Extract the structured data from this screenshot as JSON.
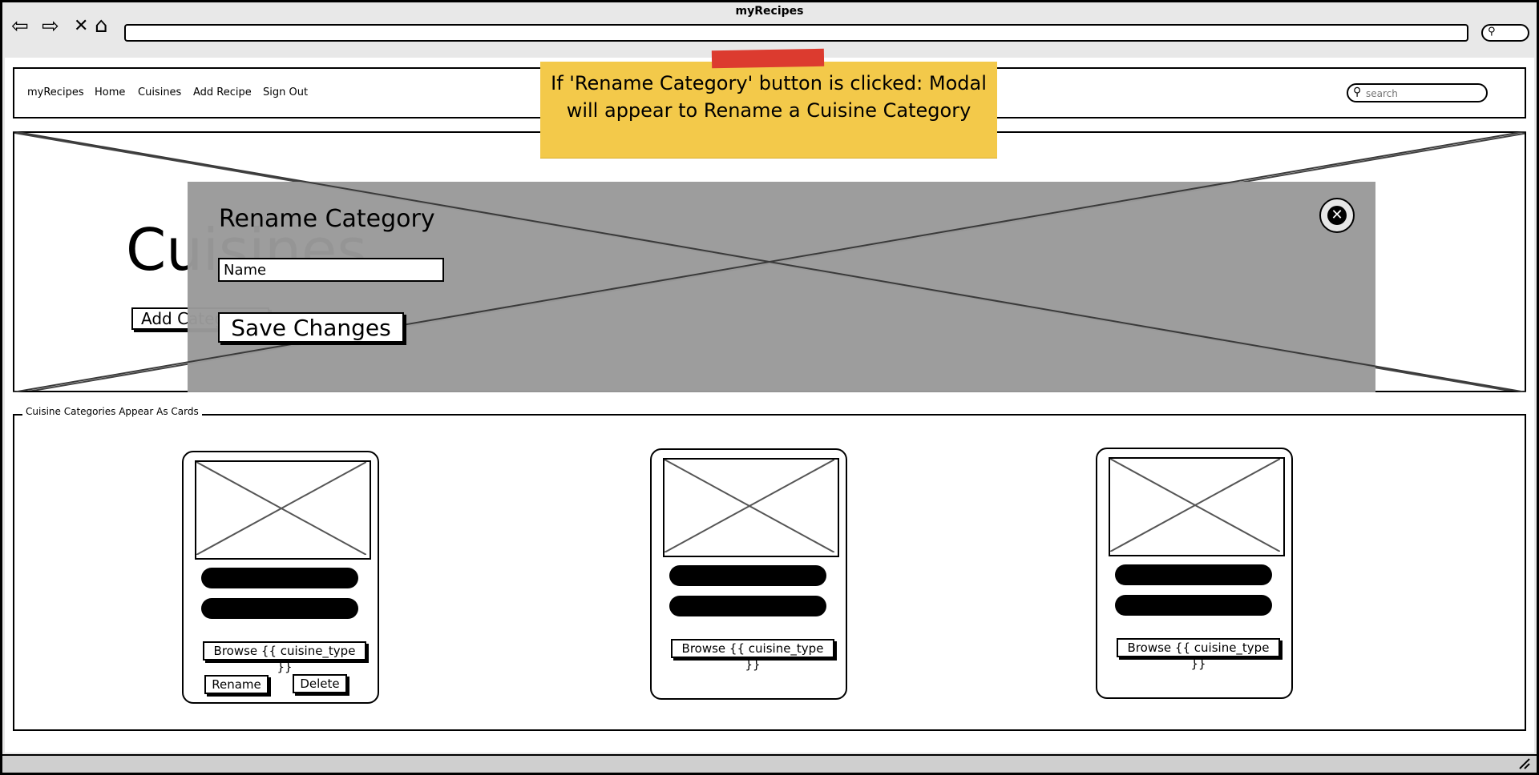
{
  "window": {
    "title": "myRecipes"
  },
  "browser": {
    "back_icon": "⇦",
    "forward_icon": "⇨",
    "stop_icon": "✕",
    "home_icon": "⌂",
    "search_glyph": "⚲"
  },
  "navbar": {
    "brand": "myRecipes",
    "links": [
      "Home",
      "Cuisines",
      "Add Recipe",
      "Sign Out"
    ],
    "search_placeholder": "search"
  },
  "hero": {
    "title": "Cuisines",
    "add_button": "Add Category"
  },
  "modal": {
    "title": "Rename Category",
    "name_value": "Name",
    "save_button": "Save Changes",
    "close_icon": "✕"
  },
  "sticky_note": {
    "text": "If 'Rename Category' button is clicked: Modal will appear to Rename a Cuisine Category"
  },
  "cards_section": {
    "legend": "Cuisine Categories Appear As Cards",
    "cards": [
      {
        "browse_label": "Browse {{ cuisine_type }}",
        "rename_label": "Rename",
        "delete_label": "Delete"
      },
      {
        "browse_label": "Browse {{ cuisine_type }}"
      },
      {
        "browse_label": "Browse {{ cuisine_type }}"
      }
    ]
  }
}
